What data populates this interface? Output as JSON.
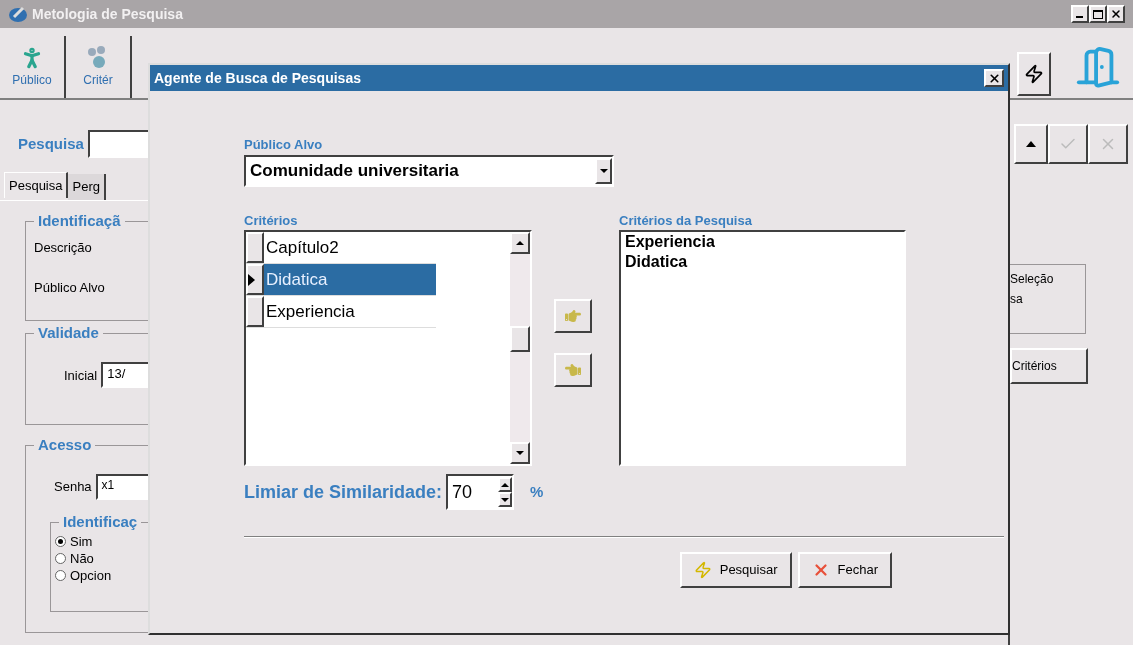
{
  "window": {
    "title": "Metologia de Pesquisa",
    "active": false
  },
  "toolbar": [
    {
      "label": "Público"
    },
    {
      "label": "Critér"
    }
  ],
  "search_row": {
    "label": "Pesquisa"
  },
  "tabs": [
    {
      "label": "Pesquisa",
      "selected": true
    },
    {
      "label": "Perg",
      "selected": false
    }
  ],
  "identification_group": {
    "title": "Identificaçã",
    "fields": [
      "Descrição",
      "Público Alvo"
    ]
  },
  "validity_group": {
    "title": "Validade",
    "field": {
      "label": "Inicial",
      "value": "13/"
    }
  },
  "access_group": {
    "title": "Acesso",
    "password": {
      "label": "Senha",
      "value": "x1"
    },
    "identification": {
      "title": "Identificaç",
      "options": [
        {
          "label": "Sim",
          "selected": true
        },
        {
          "label": "Não",
          "selected": false
        },
        {
          "label": "Opcion",
          "selected": false
        }
      ]
    }
  },
  "right_panel": {
    "group_lines": [
      "Seleção",
      "sa"
    ],
    "button": "Critérios"
  },
  "dialog": {
    "title": "Agente de Busca de Pesquisas",
    "audience": {
      "label": "Público Alvo",
      "value": "Comunidade universitaria"
    },
    "criteria": {
      "label": "Critérios",
      "rows": [
        {
          "label": "Capítulo2",
          "selected": false
        },
        {
          "label": "Didatica",
          "selected": true
        },
        {
          "label": "Experiencia",
          "selected": false
        }
      ]
    },
    "search_criteria": {
      "label": "Critérios da Pesquisa",
      "items": [
        "Experiencia",
        "Didatica"
      ]
    },
    "threshold": {
      "label": "Limiar de Similaridade:",
      "value": "70",
      "unit": "%"
    },
    "buttons": [
      {
        "kind": "search",
        "label": "Pesquisar"
      },
      {
        "kind": "close",
        "label": "Fechar"
      }
    ]
  }
}
